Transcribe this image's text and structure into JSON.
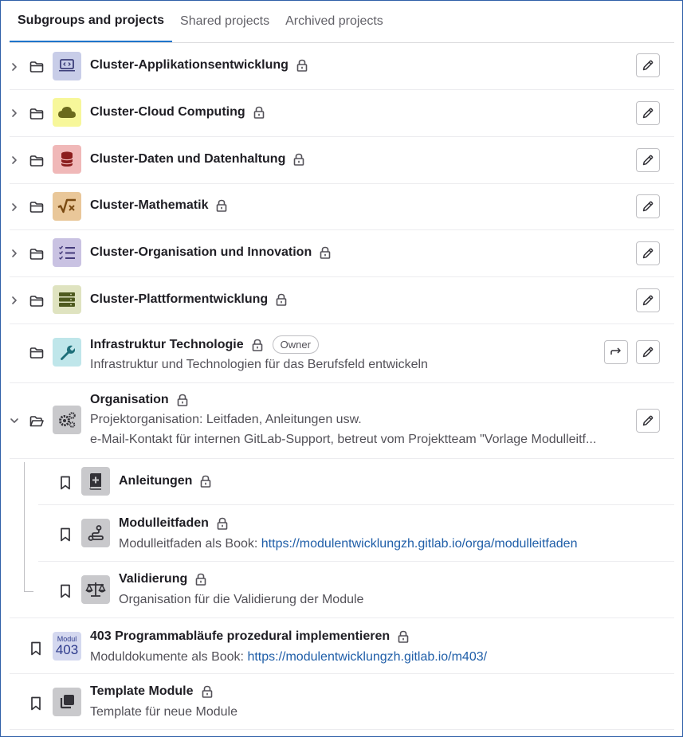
{
  "tabs": [
    {
      "label": "Subgroups and projects",
      "active": true
    },
    {
      "label": "Shared projects",
      "active": false
    },
    {
      "label": "Archived projects",
      "active": false
    }
  ],
  "groups": [
    {
      "name": "Cluster-Applikationsentwicklung",
      "icon": "laptop-code-icon",
      "color": "#c8cde8"
    },
    {
      "name": "Cluster-Cloud Computing",
      "icon": "cloud-icon",
      "color": "#f7f79a"
    },
    {
      "name": "Cluster-Daten und Datenhaltung",
      "icon": "database-icon",
      "color": "#f0b8b8"
    },
    {
      "name": "Cluster-Mathematik",
      "icon": "square-root-icon",
      "color": "#e9c799"
    },
    {
      "name": "Cluster-Organisation und Innovation",
      "icon": "checklist-icon",
      "color": "#c9c2e2"
    },
    {
      "name": "Cluster-Plattformentwicklung",
      "icon": "server-icon",
      "color": "#dfe3c0"
    }
  ],
  "infra": {
    "name": "Infrastruktur Technologie",
    "badge": "Owner",
    "description": "Infrastruktur und Technologien für das Berufsfeld entwickeln",
    "icon": "wrench-icon",
    "color": "#bfe6ea"
  },
  "orga": {
    "name": "Organisation",
    "description_line1": "Projektorganisation: Leitfaden, Anleitungen usw.",
    "description_line2": "e-Mail-Kontakt für internen GitLab-Support, betreut vom Projektteam \"Vorlage Modulleitf...",
    "icon": "gears-icon",
    "color": "#c9c9cc"
  },
  "orga_children": [
    {
      "name": "Anleitungen",
      "icon": "book-plus-icon"
    },
    {
      "name": "Modulleitfaden",
      "desc_prefix": "Modulleitfaden als Book: ",
      "link": "https://modulentwicklungzh.gitlab.io/orga/modulleitfaden",
      "icon": "route-icon"
    },
    {
      "name": "Validierung",
      "desc": "Organisation für die Validierung der Module",
      "icon": "scale-icon"
    }
  ],
  "projects": [
    {
      "name": "403 Programmabläufe prozedural implementieren",
      "desc_prefix": "Moduldokumente als Book: ",
      "link": "https://modulentwicklungzh.gitlab.io/m403/",
      "avatar_top": "Modul",
      "avatar_num": "403"
    },
    {
      "name": "Template Module",
      "desc": "Template für neue Module",
      "icon": "copy-icon"
    }
  ],
  "colors": {
    "accent": "#1f75cb",
    "link": "#1f5ea8",
    "border": "#ececef"
  }
}
